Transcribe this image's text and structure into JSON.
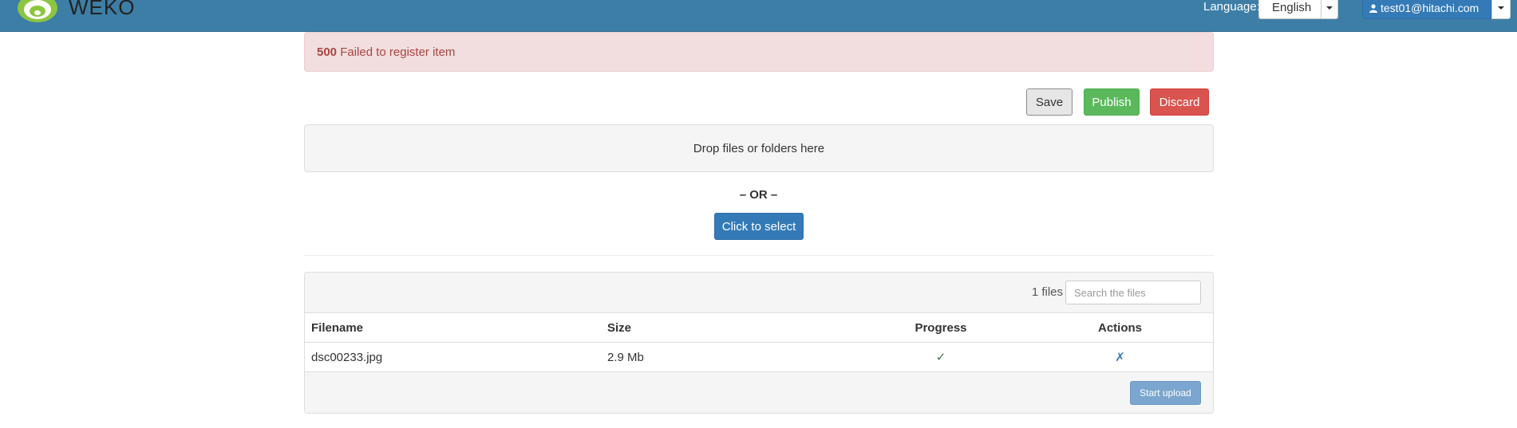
{
  "header": {
    "brand": "WEKO",
    "language_label": "Language:",
    "language_value": "English",
    "user": "test01@hitachi.com"
  },
  "alert": {
    "code": "500",
    "message": "Failed to register item"
  },
  "actions": {
    "save": "Save",
    "publish": "Publish",
    "discard": "Discard"
  },
  "upload": {
    "drop_text": "Drop files or folders here",
    "or_text": "– OR –",
    "select_button": "Click to select"
  },
  "files": {
    "count_text": "1 files",
    "search_placeholder": "Search the files",
    "columns": [
      "Filename",
      "Size",
      "Progress",
      "Actions"
    ],
    "rows": [
      {
        "filename": "dsc00233.jpg",
        "size": "2.9 Mb",
        "progress_icon": "✓",
        "action_icon": "✗"
      }
    ],
    "start_upload": "Start upload"
  },
  "colors": {
    "navbar": "#3d7ea6",
    "primary": "#337ab7",
    "success": "#5cb85c",
    "danger": "#d9534f",
    "alert_bg": "#f2dede",
    "alert_text": "#a94442"
  }
}
